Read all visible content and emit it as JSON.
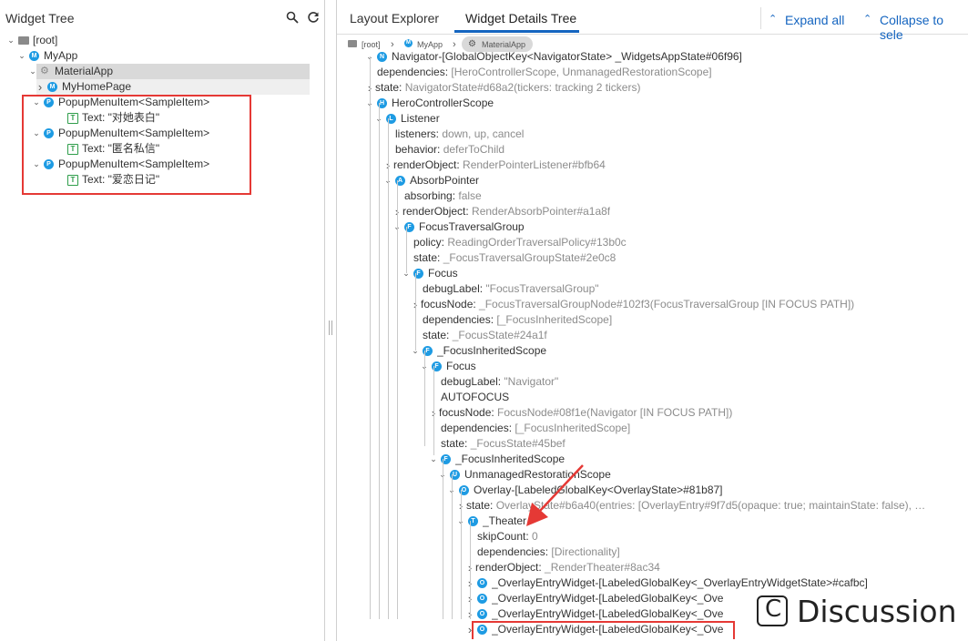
{
  "left_panel": {
    "title": "Widget Tree",
    "tree": [
      {
        "chev": "v",
        "icon": "folder",
        "label": "[root]"
      },
      {
        "chev": "v",
        "icon": "M",
        "label": "MyApp"
      },
      {
        "chev": "v",
        "icon": "gear",
        "label": "MaterialApp"
      },
      {
        "chev": ">",
        "icon": "M",
        "label": "MyHomePage"
      },
      {
        "chev": "v",
        "icon": "P",
        "label": "PopupMenuItem<SampleItem>"
      },
      {
        "chev": "",
        "icon": "T",
        "label": "Text: \"对她表白\""
      },
      {
        "chev": "v",
        "icon": "P",
        "label": "PopupMenuItem<SampleItem>"
      },
      {
        "chev": "",
        "icon": "T",
        "label": "Text: \"匿名私信\""
      },
      {
        "chev": "v",
        "icon": "P",
        "label": "PopupMenuItem<SampleItem>"
      },
      {
        "chev": "",
        "icon": "T",
        "label": "Text: \"爱恋日记\""
      }
    ]
  },
  "right_panel": {
    "tabs": [
      "Layout Explorer",
      "Widget Details Tree"
    ],
    "expand_all": "Expand all",
    "collapse_to_selected": "Collapse to sele",
    "breadcrumb": [
      "[root]",
      "MyApp",
      "MaterialApp"
    ],
    "details": [
      {
        "chev": "v",
        "icon": "N",
        "key": "Navigator-[GlobalObjectKey<NavigatorState> _WidgetsAppState#06f96]",
        "value": ""
      },
      {
        "chev": "",
        "icon": "",
        "key": "dependencies:",
        "value": "[HeroControllerScope, UnmanagedRestorationScope]"
      },
      {
        "chev": ">",
        "icon": "",
        "key": "state:",
        "value": "NavigatorState#d68a2(tickers: tracking 2 tickers)"
      },
      {
        "chev": "v",
        "icon": "H",
        "key": "HeroControllerScope",
        "value": ""
      },
      {
        "chev": "v",
        "icon": "L",
        "key": "Listener",
        "value": ""
      },
      {
        "chev": "",
        "icon": "",
        "key": "listeners:",
        "value": "down, up, cancel"
      },
      {
        "chev": "",
        "icon": "",
        "key": "behavior:",
        "value": "deferToChild"
      },
      {
        "chev": ">",
        "icon": "",
        "key": "renderObject:",
        "value": "RenderPointerListener#bfb64"
      },
      {
        "chev": "v",
        "icon": "A",
        "key": "AbsorbPointer",
        "value": ""
      },
      {
        "chev": "",
        "icon": "",
        "key": "absorbing:",
        "value": "false"
      },
      {
        "chev": ">",
        "icon": "",
        "key": "renderObject:",
        "value": "RenderAbsorbPointer#a1a8f"
      },
      {
        "chev": "v",
        "icon": "F",
        "key": "FocusTraversalGroup",
        "value": ""
      },
      {
        "chev": "",
        "icon": "",
        "key": "policy:",
        "value": "ReadingOrderTraversalPolicy#13b0c"
      },
      {
        "chev": "",
        "icon": "",
        "key": "state:",
        "value": "_FocusTraversalGroupState#2e0c8"
      },
      {
        "chev": "v",
        "icon": "F",
        "key": "Focus",
        "value": ""
      },
      {
        "chev": "",
        "icon": "",
        "key": "debugLabel:",
        "value": "\"FocusTraversalGroup\""
      },
      {
        "chev": ">",
        "icon": "",
        "key": "focusNode:",
        "value": "_FocusTraversalGroupNode#102f3(FocusTraversalGroup [IN FOCUS PATH])"
      },
      {
        "chev": "",
        "icon": "",
        "key": "dependencies:",
        "value": "[_FocusInheritedScope]"
      },
      {
        "chev": "",
        "icon": "",
        "key": "state:",
        "value": "_FocusState#24a1f"
      },
      {
        "chev": "v",
        "icon": "F",
        "key": "_FocusInheritedScope",
        "value": ""
      },
      {
        "chev": "v",
        "icon": "F",
        "key": "Focus",
        "value": ""
      },
      {
        "chev": "",
        "icon": "",
        "key": "debugLabel:",
        "value": "\"Navigator\""
      },
      {
        "chev": "",
        "icon": "",
        "key": "AUTOFOCUS",
        "value": ""
      },
      {
        "chev": ">",
        "icon": "",
        "key": "focusNode:",
        "value": "FocusNode#08f1e(Navigator [IN FOCUS PATH])"
      },
      {
        "chev": "",
        "icon": "",
        "key": "dependencies:",
        "value": "[_FocusInheritedScope]"
      },
      {
        "chev": "",
        "icon": "",
        "key": "state:",
        "value": "_FocusState#45bef"
      },
      {
        "chev": "v",
        "icon": "F",
        "key": "_FocusInheritedScope",
        "value": ""
      },
      {
        "chev": "v",
        "icon": "U",
        "key": "UnmanagedRestorationScope",
        "value": ""
      },
      {
        "chev": "v",
        "icon": "O",
        "key": "Overlay-[LabeledGlobalKey<OverlayState>#81b87]",
        "value": ""
      },
      {
        "chev": ">",
        "icon": "",
        "key": "state:",
        "value": "OverlayState#b6a40(entries: [OverlayEntry#9f7d5(opaque: true; maintainState: false), …"
      },
      {
        "chev": "v",
        "icon": "T",
        "key": "_Theater",
        "value": ""
      },
      {
        "chev": "",
        "icon": "",
        "key": "skipCount:",
        "value": "0"
      },
      {
        "chev": "",
        "icon": "",
        "key": "dependencies:",
        "value": "[Directionality]"
      },
      {
        "chev": ">",
        "icon": "",
        "key": "renderObject:",
        "value": "_RenderTheater#8ac34"
      },
      {
        "chev": ">",
        "icon": "O",
        "key": "_OverlayEntryWidget-[LabeledGlobalKey<_OverlayEntryWidgetState>#cafbc]",
        "value": ""
      },
      {
        "chev": ">",
        "icon": "O",
        "key": "_OverlayEntryWidget-[LabeledGlobalKey<_Ove",
        "value": ""
      },
      {
        "chev": ">",
        "icon": "O",
        "key": "_OverlayEntryWidget-[LabeledGlobalKey<_Ove",
        "value": ""
      },
      {
        "chev": ">",
        "icon": "O",
        "key": "_OverlayEntryWidget-[LabeledGlobalKey<_Ove",
        "value": ""
      }
    ]
  },
  "watermark": {
    "text": "Discussion"
  },
  "colors": {
    "accent": "#1565c0",
    "badge": "#1e9be3",
    "text_badge": "#2e9d4a",
    "annotation": "#e53935",
    "selection": "#d9d9d9"
  }
}
